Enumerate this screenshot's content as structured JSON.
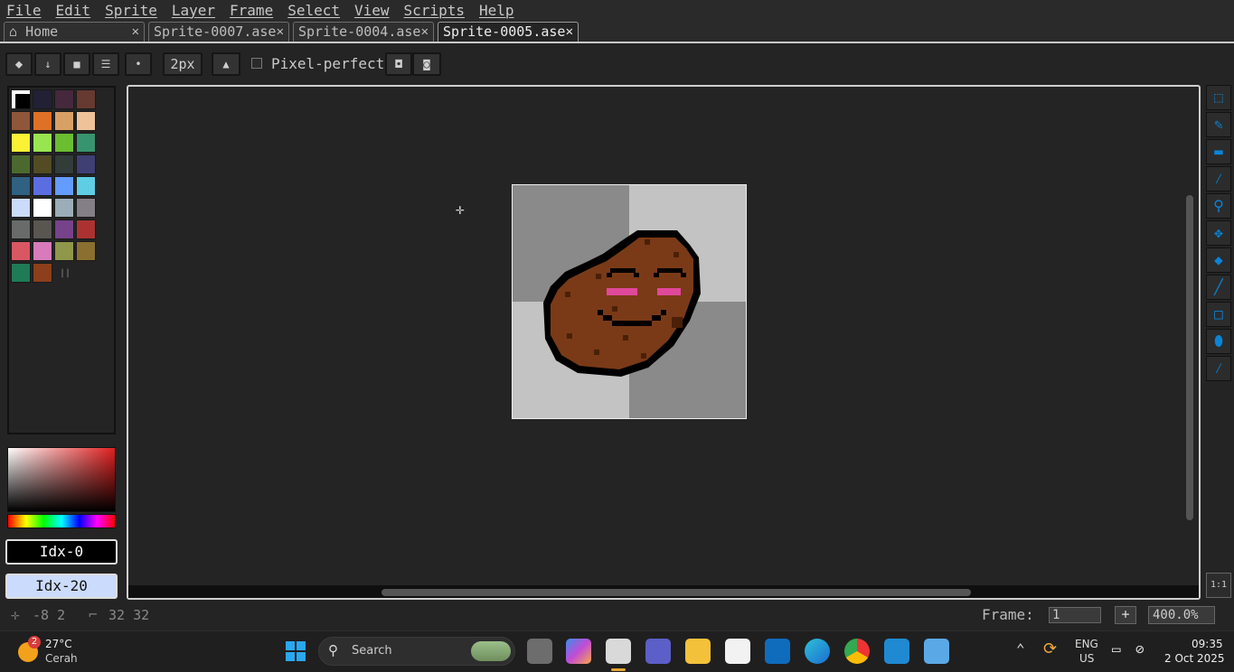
{
  "menu": [
    "File",
    "Edit",
    "Sprite",
    "Layer",
    "Frame",
    "Select",
    "View",
    "Scripts",
    "Help"
  ],
  "tabs": [
    {
      "label": "Home",
      "icon": "home-icon",
      "active": false
    },
    {
      "label": "Sprite-0007.ase",
      "active": false
    },
    {
      "label": "Sprite-0004.ase",
      "active": false
    },
    {
      "label": "Sprite-0005.ase",
      "active": true
    }
  ],
  "tab_close_glyph": "✕",
  "toolbar": {
    "brush_size_label": "2px",
    "pixel_perfect_label": "Pixel-perfect",
    "pixel_perfect_checked": false
  },
  "palette": {
    "colors": [
      "#000000",
      "#222034",
      "#45283c",
      "#663931",
      "#8f563b",
      "#df7126",
      "#d9a066",
      "#eec39a",
      "#fbf236",
      "#99e550",
      "#6abe30",
      "#37946e",
      "#4b692f",
      "#524b24",
      "#323c39",
      "#3f3f74",
      "#306082",
      "#5b6ee1",
      "#639bff",
      "#5fcde4",
      "#cbdbfc",
      "#ffffff",
      "#9badb7",
      "#847e87",
      "#696a6a",
      "#595652",
      "#76428a",
      "#ac3232",
      "#d95763",
      "#d77bba",
      "#8f974a",
      "#8a6f30",
      "#1f7a56",
      "#8b3f1a"
    ]
  },
  "color_bar": {
    "fg_label": "Idx-0",
    "bg_label": "Idx-20",
    "fg_color": "#000000",
    "bg_color": "#cbdbfc"
  },
  "tools": [
    "marquee-icon",
    "pencil-icon",
    "eraser-icon",
    "eyedropper-icon",
    "zoom-icon",
    "move-icon",
    "paint-bucket-icon",
    "line-icon",
    "rectangle-icon",
    "contour-icon",
    "blur-icon"
  ],
  "tools_bottom_label": "1:1",
  "status": {
    "cursor_pos": "-8 2",
    "sprite_size": "32 32",
    "frame_label": "Frame:",
    "frame_value": "1",
    "add_frame": "+",
    "zoom": "400.0%"
  },
  "taskbar": {
    "weather_temp": "27°C",
    "weather_desc": "Cerah",
    "weather_badge": "2",
    "search_placeholder": "Search",
    "lang_1": "ENG",
    "lang_2": "US",
    "time": "09:35",
    "date": "2 Oct 2025"
  },
  "colors": {
    "accent": "#0a84d8",
    "sprite_fill": "#7a3a17",
    "sprite_blush": "#e0489a"
  }
}
